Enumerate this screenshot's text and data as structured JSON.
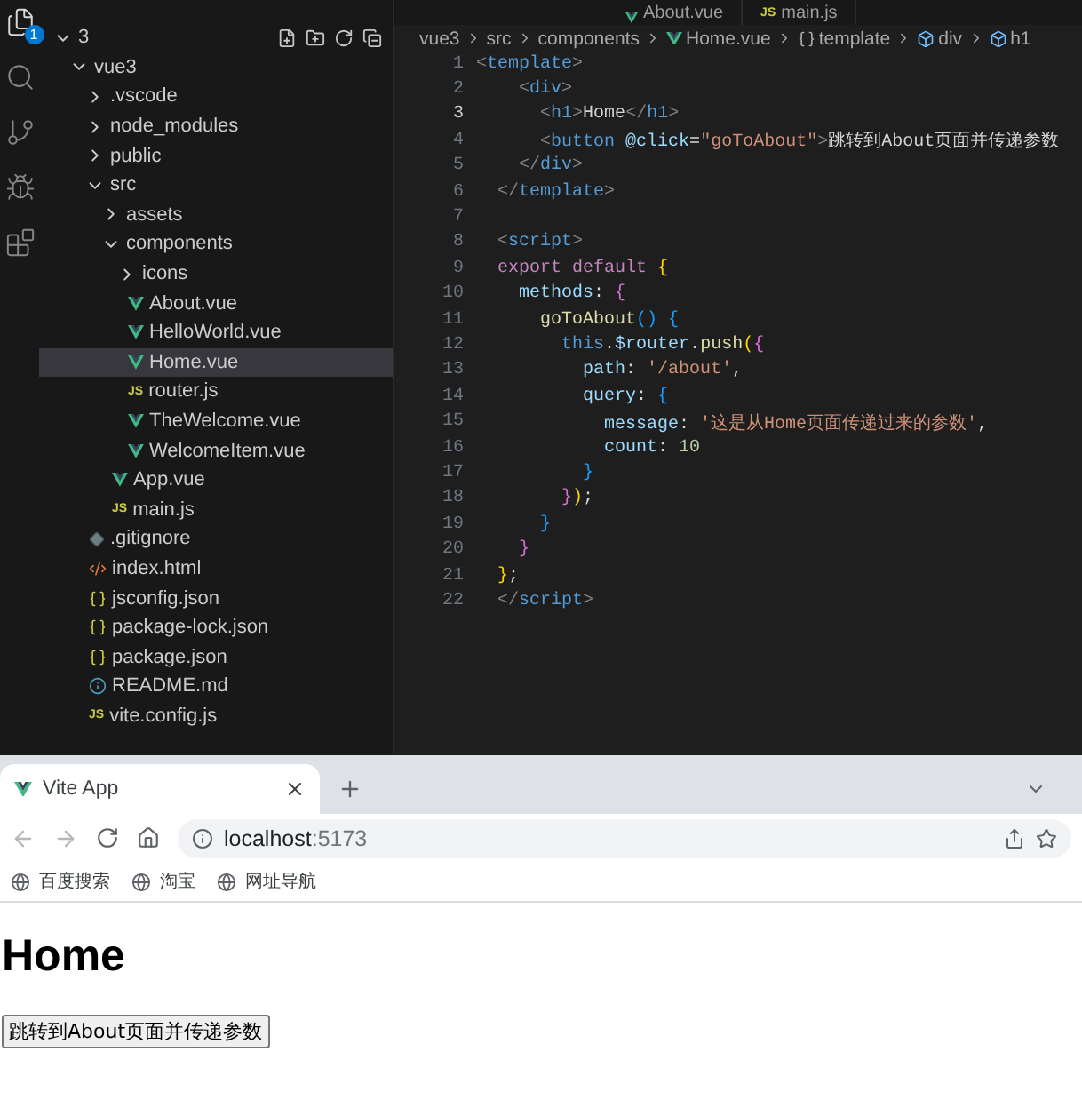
{
  "activity_bar": {
    "badge": "1",
    "items": [
      {
        "kind": "files",
        "selected": true
      },
      {
        "kind": "search",
        "selected": false
      },
      {
        "kind": "scm",
        "selected": false
      },
      {
        "kind": "debug",
        "selected": false
      },
      {
        "kind": "extensions",
        "selected": false
      }
    ]
  },
  "editor_tabs": [
    {
      "label": "About.vue",
      "kind": "vue"
    },
    {
      "label": "main.js",
      "kind": "js",
      "icon_label": "JS"
    }
  ],
  "explorer": {
    "tree": [
      {
        "label": "3",
        "kind": "folder",
        "expanded": true,
        "children": [
          {
            "label": "vue3",
            "kind": "folder",
            "expanded": true,
            "children": [
              {
                "label": ".vscode",
                "kind": "folder",
                "expanded": false
              },
              {
                "label": "node_modules",
                "kind": "folder",
                "expanded": false
              },
              {
                "label": "public",
                "kind": "folder",
                "expanded": false
              },
              {
                "label": "src",
                "kind": "folder",
                "expanded": true,
                "children": [
                  {
                    "label": "assets",
                    "kind": "folder",
                    "expanded": false
                  },
                  {
                    "label": "components",
                    "kind": "folder",
                    "expanded": true,
                    "children": [
                      {
                        "label": "icons",
                        "kind": "folder",
                        "expanded": false
                      },
                      {
                        "label": "About.vue",
                        "kind": "vue",
                        "selected": false
                      },
                      {
                        "label": "HelloWorld.vue",
                        "kind": "vue",
                        "selected": false
                      },
                      {
                        "label": "Home.vue",
                        "kind": "vue",
                        "selected": true
                      },
                      {
                        "label": "router.js",
                        "kind": "js",
                        "icon_label": "JS",
                        "selected": false
                      },
                      {
                        "label": "TheWelcome.vue",
                        "kind": "vue",
                        "selected": false
                      },
                      {
                        "label": "WelcomeItem.vue",
                        "kind": "vue",
                        "selected": false
                      }
                    ]
                  },
                  {
                    "label": "App.vue",
                    "kind": "vue",
                    "selected": false
                  },
                  {
                    "label": "main.js",
                    "kind": "js",
                    "icon_label": "JS",
                    "selected": false
                  }
                ]
              },
              {
                "label": ".gitignore",
                "kind": "git",
                "selected": false
              },
              {
                "label": "index.html",
                "kind": "html",
                "selected": false
              },
              {
                "label": "jsconfig.json",
                "kind": "json",
                "selected": false
              },
              {
                "label": "package-lock.json",
                "kind": "json",
                "selected": false
              },
              {
                "label": "package.json",
                "kind": "json",
                "selected": false
              },
              {
                "label": "README.md",
                "kind": "info",
                "selected": false
              },
              {
                "label": "vite.config.js",
                "kind": "js",
                "icon_label": "JS",
                "selected": false
              }
            ]
          }
        ]
      }
    ]
  },
  "breadcrumb": [
    {
      "label": "vue3",
      "kind": "folder"
    },
    {
      "label": "src",
      "kind": "folder"
    },
    {
      "label": "components",
      "kind": "folder"
    },
    {
      "label": "Home.vue",
      "kind": "vue"
    },
    {
      "label": "template",
      "kind": "braces"
    },
    {
      "label": "div",
      "kind": "element"
    },
    {
      "label": "h1",
      "kind": "element"
    }
  ],
  "code": [
    {
      "number": "1",
      "tokens": [
        {
          "kind": "punct",
          "text": "<"
        },
        {
          "kind": "tag",
          "text": "template"
        },
        {
          "kind": "punct",
          "text": ">"
        }
      ]
    },
    {
      "number": "2",
      "tokens": [
        {
          "kind": "punct",
          "text": "    <"
        },
        {
          "kind": "tag",
          "text": "div"
        },
        {
          "kind": "punct",
          "text": ">"
        }
      ]
    },
    {
      "number": "3",
      "tokens": [
        {
          "kind": "punct",
          "text": "      <"
        },
        {
          "kind": "tag",
          "text": "h1"
        },
        {
          "kind": "punct",
          "text": ">"
        },
        {
          "kind": "plain",
          "text": "Home"
        },
        {
          "kind": "punct",
          "text": "</"
        },
        {
          "kind": "tag",
          "text": "h1"
        },
        {
          "kind": "punct",
          "text": ">"
        }
      ]
    },
    {
      "number": "4",
      "tokens": [
        {
          "kind": "punct",
          "text": "      <"
        },
        {
          "kind": "tag",
          "text": "button"
        },
        {
          "kind": "attr",
          "text": " @click"
        },
        {
          "kind": "plain",
          "text": "="
        },
        {
          "kind": "string",
          "text": "\"goToAbout\""
        },
        {
          "kind": "punct",
          "text": ">"
        },
        {
          "kind": "plain",
          "text": "跳转到About页面并传递参数"
        }
      ]
    },
    {
      "number": "5",
      "tokens": [
        {
          "kind": "punct",
          "text": "    </"
        },
        {
          "kind": "tag",
          "text": "div"
        },
        {
          "kind": "punct",
          "text": ">"
        }
      ]
    },
    {
      "number": "6",
      "tokens": [
        {
          "kind": "punct",
          "text": "  </"
        },
        {
          "kind": "tag",
          "text": "template"
        },
        {
          "kind": "punct",
          "text": ">"
        }
      ]
    },
    {
      "number": "7"
    },
    {
      "number": "8",
      "tokens": [
        {
          "kind": "punct",
          "text": "  <"
        },
        {
          "kind": "tag",
          "text": "script"
        },
        {
          "kind": "punct",
          "text": ">"
        }
      ]
    },
    {
      "number": "9",
      "tokens": [
        {
          "kind": "keyword",
          "text": "  export default "
        },
        {
          "kind": "brace1",
          "text": "{"
        }
      ]
    },
    {
      "number": "10",
      "tokens": [
        {
          "kind": "var",
          "text": "    methods"
        },
        {
          "kind": "plain",
          "text": ": "
        },
        {
          "kind": "brace2",
          "text": "{"
        }
      ]
    },
    {
      "number": "11",
      "tokens": [
        {
          "kind": "func",
          "text": "      goToAbout"
        },
        {
          "kind": "brace3",
          "text": "() {"
        }
      ]
    },
    {
      "number": "12",
      "tokens": [
        {
          "kind": "tag",
          "text": "        this"
        },
        {
          "kind": "plain",
          "text": "."
        },
        {
          "kind": "var",
          "text": "$router"
        },
        {
          "kind": "plain",
          "text": "."
        },
        {
          "kind": "func",
          "text": "push"
        },
        {
          "kind": "brace1",
          "text": "("
        },
        {
          "kind": "brace2",
          "text": "{"
        }
      ]
    },
    {
      "number": "13",
      "tokens": [
        {
          "kind": "var",
          "text": "          path"
        },
        {
          "kind": "plain",
          "text": ": "
        },
        {
          "kind": "string",
          "text": "'/about'"
        },
        {
          "kind": "plain",
          "text": ","
        }
      ]
    },
    {
      "number": "14",
      "tokens": [
        {
          "kind": "var",
          "text": "          query"
        },
        {
          "kind": "plain",
          "text": ": "
        },
        {
          "kind": "brace3",
          "text": "{"
        }
      ]
    },
    {
      "number": "15",
      "tokens": [
        {
          "kind": "var",
          "text": "            message"
        },
        {
          "kind": "plain",
          "text": ": "
        },
        {
          "kind": "string",
          "text": "'这是从Home页面传递过来的参数'"
        },
        {
          "kind": "plain",
          "text": ","
        }
      ]
    },
    {
      "number": "16",
      "tokens": [
        {
          "kind": "var",
          "text": "            count"
        },
        {
          "kind": "plain",
          "text": ": "
        },
        {
          "kind": "number",
          "text": "10"
        }
      ]
    },
    {
      "number": "17",
      "tokens": [
        {
          "kind": "brace3",
          "text": "          }"
        }
      ]
    },
    {
      "number": "18",
      "tokens": [
        {
          "kind": "brace2",
          "text": "        }"
        },
        {
          "kind": "brace1",
          "text": ")"
        },
        {
          "kind": "plain",
          "text": ";"
        }
      ]
    },
    {
      "number": "19",
      "tokens": [
        {
          "kind": "brace3",
          "text": "      }"
        }
      ]
    },
    {
      "number": "20",
      "tokens": [
        {
          "kind": "brace2",
          "text": "    }"
        }
      ]
    },
    {
      "number": "21",
      "tokens": [
        {
          "kind": "brace1",
          "text": "  }"
        },
        {
          "kind": "plain",
          "text": ";"
        }
      ]
    },
    {
      "number": "22",
      "tokens": [
        {
          "kind": "punct",
          "text": "  </"
        },
        {
          "kind": "tag",
          "text": "script"
        },
        {
          "kind": "punct",
          "text": ">"
        }
      ]
    }
  ],
  "browser": {
    "tab": {
      "title": "Vite App",
      "selected": true
    },
    "back_disabled": true,
    "forward_disabled": true,
    "address": {
      "host": "localhost",
      "port": ":5173"
    },
    "bookmarks": [
      "百度搜索",
      "淘宝",
      "网址导航"
    ],
    "page": {
      "heading": "Home",
      "button": "跳转到About页面并传递参数"
    }
  }
}
